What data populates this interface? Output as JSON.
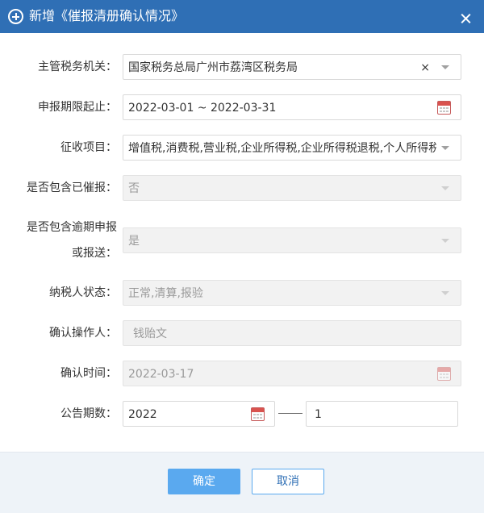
{
  "dialog": {
    "title": "新增《催报清册确认情况》",
    "close_icon": "close-icon",
    "title_icon": "plus-circle-icon"
  },
  "form": {
    "tax_authority": {
      "label": "主管税务机关：",
      "value": "国家税务总局广州市荔湾区税务局",
      "clear": "×"
    },
    "period": {
      "label": "申报期限起止：",
      "value": "2022-03-01 ~ 2022-03-31"
    },
    "items": {
      "label": "征收项目：",
      "value": "增值税,消费税,营业税,企业所得税,企业所得税退税,个人所得税,..."
    },
    "include_urged": {
      "label": "是否包含已催报：",
      "value": "否"
    },
    "include_overdue": {
      "label_line1": "是否包含逾期申报",
      "label_line2": "或报送：",
      "value": "是"
    },
    "taxpayer_status": {
      "label": "纳税人状态：",
      "value": "正常,清算,报验"
    },
    "operator": {
      "label": "确认操作人：",
      "value": "钱贻文"
    },
    "confirm_time": {
      "label": "确认时间：",
      "value": "2022-03-17"
    },
    "notice_period": {
      "label": "公告期数：",
      "year": "2022",
      "number": "1"
    }
  },
  "footer": {
    "confirm_label": "确定",
    "cancel_label": "取消"
  },
  "colors": {
    "titlebar": "#2f6fb5",
    "primary_button": "#5aa9ef",
    "footer_bg": "#eef3f8"
  }
}
